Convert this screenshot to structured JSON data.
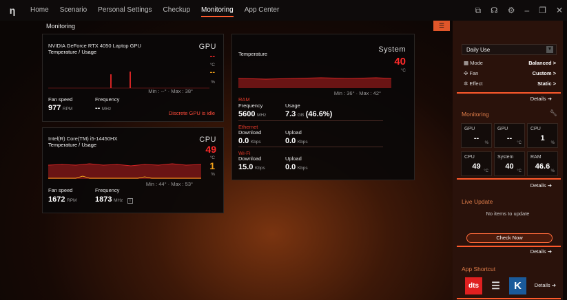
{
  "nav": [
    "Home",
    "Scenario",
    "Personal Settings",
    "Checkup",
    "Monitoring",
    "App Center"
  ],
  "page_title": "Monitoring",
  "gpu": {
    "name": "NVIDIA GeForce RTX 4050 Laptop GPU",
    "sub": "Temperature / Usage",
    "label": "GPU",
    "temp": "--",
    "temp_unit": "°C",
    "usage": "--",
    "usage_unit": "%",
    "minmax": "Min : --°  ·  Max : 38°",
    "fan_label": "Fan speed",
    "fan_value": "977",
    "fan_unit": "RPM",
    "freq_label": "Frequency",
    "freq_value": "--",
    "freq_unit": "MHz",
    "idle": "Discrete GPU is idle"
  },
  "cpu": {
    "name": "Intel(R) Core(TM) i5-14450HX",
    "sub": "Temperature / Usage",
    "label": "CPU",
    "temp": "49",
    "temp_unit": "°C",
    "usage": "1",
    "usage_unit": "%",
    "minmax": "Min : 44°  ·  Max : 53°",
    "fan_label": "Fan speed",
    "fan_value": "1672",
    "fan_unit": "RPM",
    "freq_label": "Frequency",
    "freq_value": "1873",
    "freq_unit": "MHz"
  },
  "system": {
    "label": "System",
    "temp_label": "Temperature",
    "temp": "40",
    "temp_unit": "°C",
    "minmax": "Min : 36°  ·  Max : 42°",
    "ram_label": "RAM",
    "ram_freq_label": "Frequency",
    "ram_freq": "5600",
    "ram_freq_unit": "MHz",
    "ram_usage_label": "Usage",
    "ram_usage": "7.3",
    "ram_usage_unit": "GB",
    "ram_usage_pct": "(46.6%)",
    "eth_label": "Ethernet",
    "eth_dl_label": "Download",
    "eth_dl": "0.0",
    "eth_dl_unit": "Kbps",
    "eth_ul_label": "Upload",
    "eth_ul": "0.0",
    "eth_ul_unit": "Kbps",
    "wifi_label": "Wi-Fi",
    "wifi_dl_label": "Download",
    "wifi_dl": "15.0",
    "wifi_dl_unit": "Kbps",
    "wifi_ul_label": "Upload",
    "wifi_ul": "0.0",
    "wifi_ul_unit": "Kbps"
  },
  "sidebar": {
    "profile": "Daily Use",
    "mode_label": "Mode",
    "mode_value": "Balanced >",
    "fan_label": "Fan",
    "fan_value": "Custom >",
    "effect_label": "Effect",
    "effect_value": "Static >",
    "details": "Details ➔",
    "monitoring_header": "Monitoring",
    "tiles": [
      {
        "label": "GPU",
        "value": "--",
        "unit": "%"
      },
      {
        "label": "GPU",
        "value": "--",
        "unit": "°C"
      },
      {
        "label": "CPU",
        "value": "1",
        "unit": "%"
      },
      {
        "label": "CPU",
        "value": "49",
        "unit": "°C"
      },
      {
        "label": "System",
        "value": "40",
        "unit": "°C"
      },
      {
        "label": "RAM",
        "value": "46.6",
        "unit": "%"
      }
    ],
    "live_update_header": "Live Update",
    "no_items": "No items to update",
    "check_now": "Check Now",
    "app_shortcut_header": "App Shortcut",
    "apps": [
      "dts",
      "K"
    ]
  },
  "colors": {
    "accent": "#ff5a2c",
    "red": "#ff2a2a",
    "orange": "#f5a31a"
  }
}
